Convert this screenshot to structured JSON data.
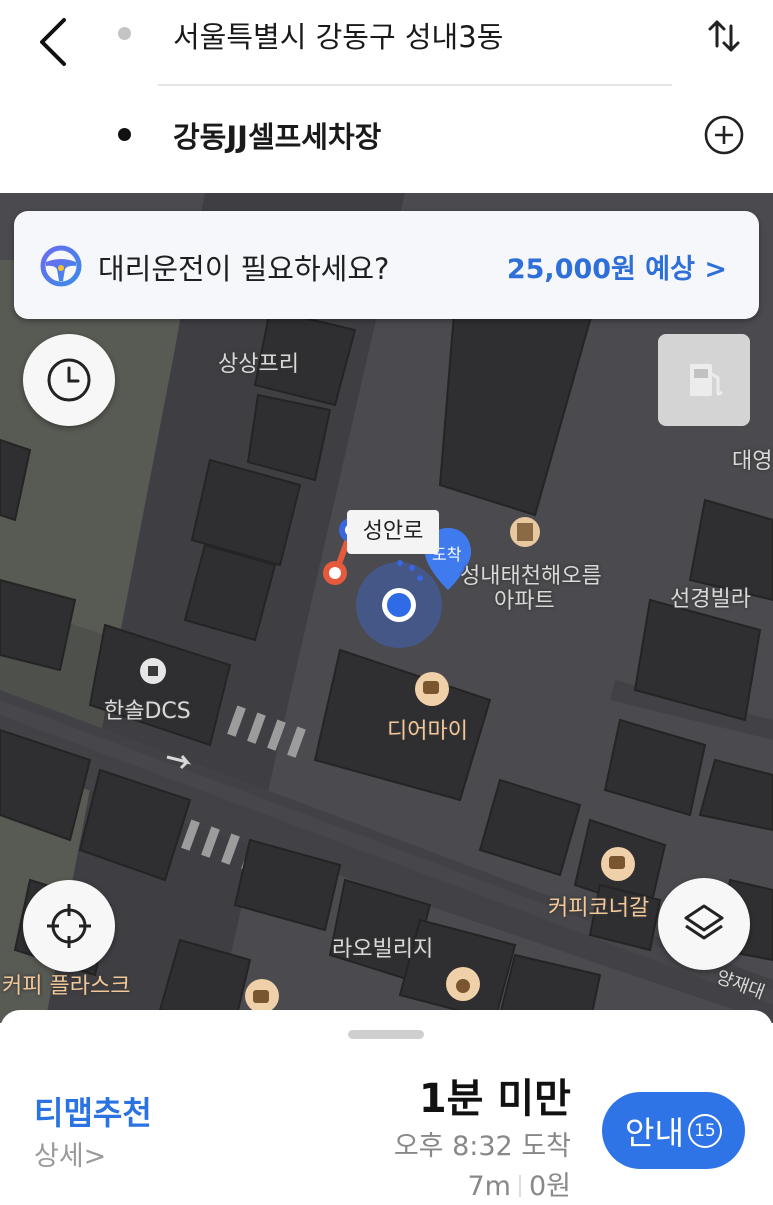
{
  "header": {
    "origin": "서울특별시 강동구 성내3동",
    "destination": "강동JJ셀프세차장"
  },
  "banner": {
    "text": "대리운전이 필요하세요?",
    "price": "25,000원 예상 >"
  },
  "map": {
    "labels": {
      "sangsang": "상상프리",
      "daeyoung": "대영",
      "seongan": "성안로",
      "arrive_pin": "도착",
      "apt1": "성내태천해오름",
      "apt2": "아파트",
      "seongyeong": "선경빌라",
      "hansol": "한솔DCS",
      "dear": "디어마이",
      "coffee_corner": "커피코너갈",
      "raov": "라오빌리지",
      "coffee_plus": "커피 플라스크",
      "yangjae": "양재대"
    }
  },
  "sheet": {
    "recommend": "티맵추천",
    "detail": "상세>",
    "eta": "1분 미만",
    "arrive": "오후 8:32 도착",
    "distance": "7m",
    "toll": "0원",
    "guide_label": "안내",
    "guide_count": "15"
  },
  "colors": {
    "accent": "#2f74e6",
    "map_bg": "#4b4b4f",
    "route": "#e55a3c"
  }
}
